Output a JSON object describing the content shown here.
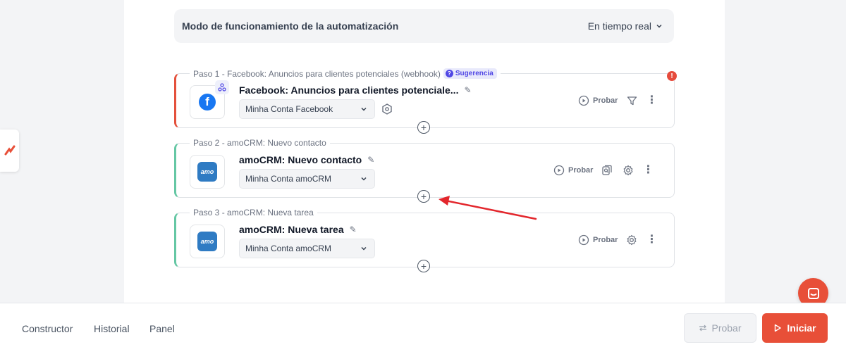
{
  "mode": {
    "title": "Modo de funcionamiento de la automatización",
    "value": "En tiempo real"
  },
  "steps": [
    {
      "label": "Paso 1 - Facebook: Anuncios para clientes potenciales (webhook)",
      "badge": "Sugerencia",
      "title": "Facebook: Anuncios para clientes potenciale...",
      "account": "Minha Conta Facebook",
      "probar": "Probar",
      "status_color": "#e4513c"
    },
    {
      "label": "Paso 2 - amoCRM: Nuevo contacto",
      "title": "amoCRM: Nuevo contacto",
      "account": "Minha Conta amoCRM",
      "probar": "Probar",
      "status_color": "#65c7a4"
    },
    {
      "label": "Paso 3 - amoCRM: Nueva tarea",
      "title": "amoCRM: Nueva tarea",
      "account": "Minha Conta amoCRM",
      "probar": "Probar",
      "status_color": "#65c7a4"
    }
  ],
  "icons": {
    "facebook": "facebook-icon",
    "amocrm": "amocrm-icon",
    "webhook": "webhook-icon",
    "alert": "alert-icon",
    "chat": "chat-icon"
  },
  "bottom_nav": {
    "items": [
      "Constructor",
      "Historial",
      "Panel"
    ],
    "probar": "Probar",
    "iniciar": "Iniciar"
  },
  "colors": {
    "accent": "#e84f38",
    "arrow": "#e3262c",
    "suggestion": "#4f46e5"
  }
}
